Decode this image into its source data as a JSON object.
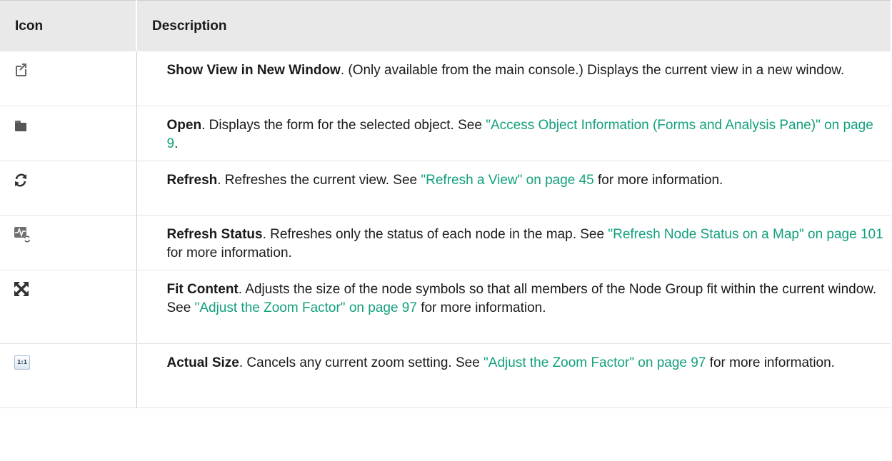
{
  "table": {
    "headers": {
      "icon": "Icon",
      "description": "Description"
    },
    "rows": [
      {
        "icon": "new-window-icon",
        "term": "Show View in New Window",
        "text": ". (Only available from the main console.) Displays the current view in a new window."
      },
      {
        "icon": "folder-open-icon",
        "term": "Open",
        "text": ". Displays the form for the selected object. See ",
        "link": "\"Access Object Information (Forms and Analysis Pane)\" on page 9",
        "after": "."
      },
      {
        "icon": "refresh-icon",
        "term": "Refresh",
        "text": ". Refreshes the current view. See ",
        "link": "\"Refresh a View\" on page 45",
        "after": " for more information."
      },
      {
        "icon": "refresh-status-icon",
        "term": "Refresh Status",
        "text": ". Refreshes only the status of each node in the map. See ",
        "link": "\"Refresh Node Status on a Map\" on page 101",
        "after": " for more information."
      },
      {
        "icon": "fit-content-icon",
        "term": "Fit Content",
        "text": ". Adjusts the size of the node symbols so that all members of the Node Group fit within the current window. See ",
        "link": "\"Adjust the Zoom Factor\" on page 97",
        "after": " for more information."
      },
      {
        "icon": "actual-size-icon",
        "icon_label": "1:1",
        "term": "Actual Size",
        "text": ". Cancels any current zoom setting. See ",
        "link": "\"Adjust the Zoom Factor\" on page 97",
        "after": " for more information."
      }
    ]
  },
  "colors": {
    "link": "#13a07e",
    "header_bg": "#e9e9e9"
  }
}
